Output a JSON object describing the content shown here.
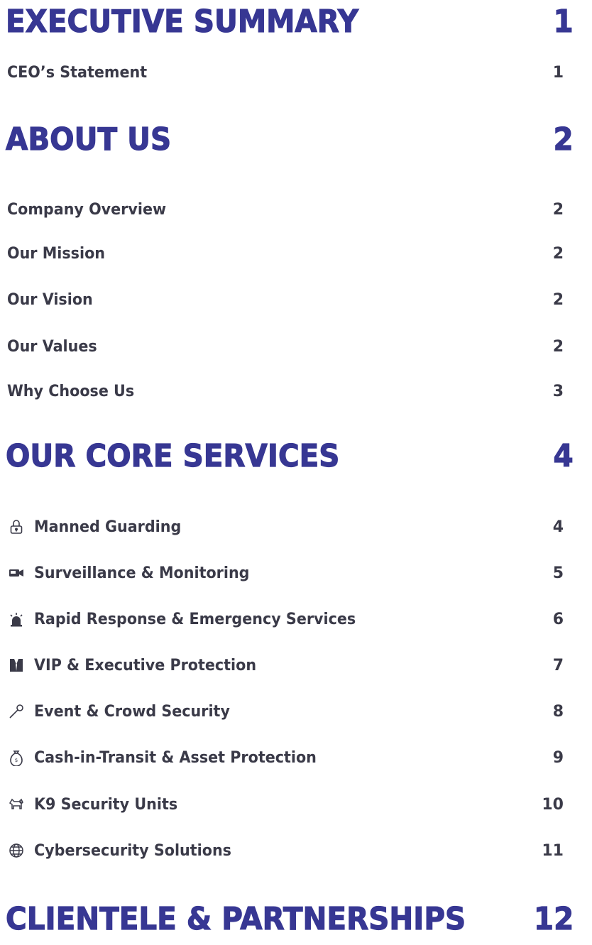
{
  "toc": {
    "executive_summary": {
      "title": "EXECUTIVE SUMMARY",
      "page": "1",
      "items": [
        {
          "label": "CEO’s Statement",
          "page": "1"
        }
      ]
    },
    "about_us": {
      "title": "ABOUT US",
      "page": "2",
      "items": [
        {
          "label": "Company Overview",
          "page": "2"
        },
        {
          "label": "Our Mission",
          "page": "2"
        },
        {
          "label": "Our Vision",
          "page": "2"
        },
        {
          "label": "Our Values",
          "page": "2"
        },
        {
          "label": "Why Choose Us",
          "page": "3"
        }
      ]
    },
    "core_services": {
      "title": "OUR CORE SERVICES",
      "page": "4",
      "items": [
        {
          "icon": "padlock-icon",
          "label": "Manned Guarding",
          "page": "4"
        },
        {
          "icon": "video-camera-icon",
          "label": "Surveillance & Monitoring",
          "page": "5"
        },
        {
          "icon": "siren-icon",
          "label": "Rapid Response & Emergency Services",
          "page": "6"
        },
        {
          "icon": "suit-icon",
          "label": "VIP & Executive Protection",
          "page": "7"
        },
        {
          "icon": "microphone-icon",
          "label": "Event & Crowd Security",
          "page": "8"
        },
        {
          "icon": "money-bag-icon",
          "label": "Cash-in-Transit & Asset Protection",
          "page": "9"
        },
        {
          "icon": "dog-icon",
          "label": "K9 Security Units",
          "page": "10"
        },
        {
          "icon": "globe-icon",
          "label": "Cybersecurity Solutions",
          "page": "11"
        }
      ]
    },
    "clientele": {
      "title": "CLIENTELE & PARTNERSHIPS",
      "page": "12"
    }
  },
  "colors": {
    "heading": "#373793",
    "text": "#3a3a48"
  }
}
